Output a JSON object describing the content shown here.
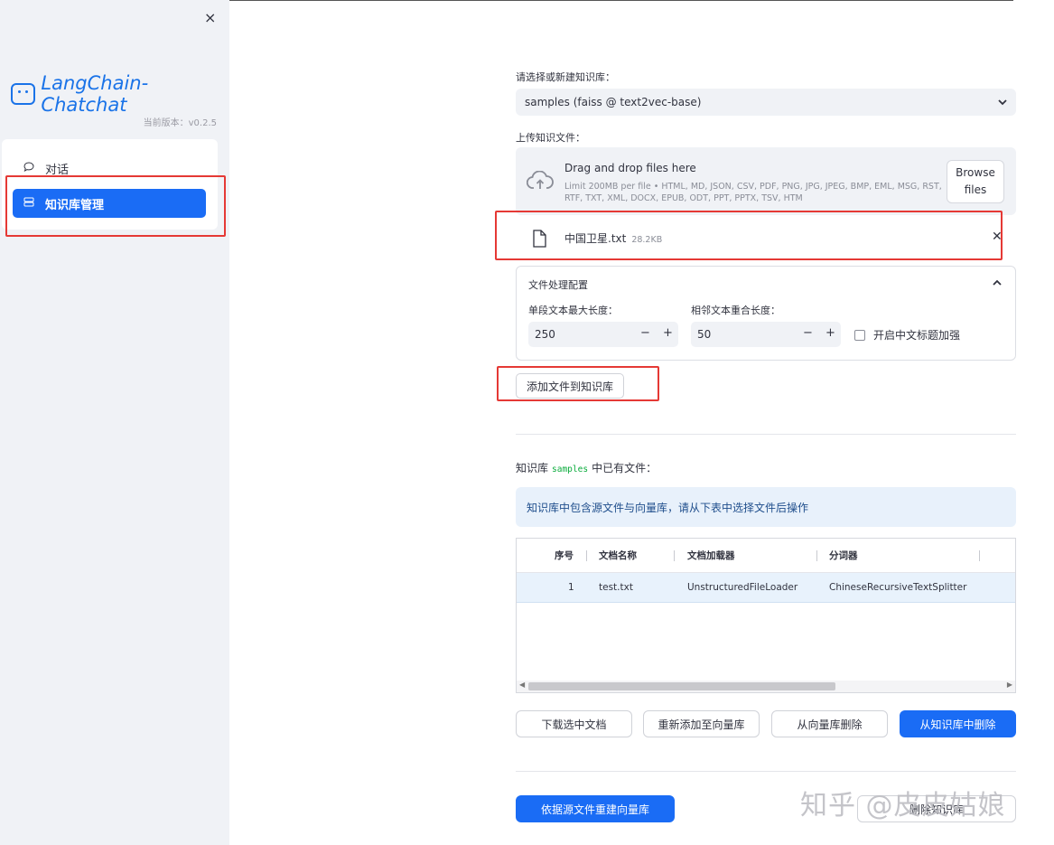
{
  "sidebar": {
    "close_glyph": "×",
    "logo_text": "LangChain-Chatchat",
    "version": "当前版本：v0.2.5",
    "nav": [
      {
        "label": "对话",
        "icon": "chat-bubble-icon"
      },
      {
        "label": "知识库管理",
        "icon": "database-icon"
      }
    ]
  },
  "kb_select": {
    "label": "请选择或新建知识库：",
    "value": "samples (faiss @ text2vec-base)"
  },
  "upload": {
    "label": "上传知识文件：",
    "drop_title": "Drag and drop files here",
    "limit": "Limit 200MB per file • HTML, MD, JSON, CSV, PDF, PNG, JPG, JPEG, BMP, EML, MSG, RST, RTF, TXT, XML, DOCX, EPUB, ODT, PPT, PPTX, TSV, HTM",
    "browse_label": "Browse files",
    "file_name": "中国卫星.txt",
    "file_size": "28.2KB"
  },
  "config": {
    "title": "文件处理配置",
    "max_len_label": "单段文本最大长度：",
    "max_len_value": "250",
    "overlap_label": "相邻文本重合长度：",
    "overlap_value": "50",
    "zh_title_label": "开启中文标题加强",
    "zh_title_checked": false
  },
  "add_button": "添加文件到知识库",
  "existing": {
    "prefix": "知识库",
    "kb_name": "samples",
    "suffix": "中已有文件：",
    "info": "知识库中包含源文件与向量库，请从下表中选择文件后操作",
    "columns": [
      "序号",
      "文档名称",
      "文档加载器",
      "分词器"
    ],
    "rows": [
      {
        "no": "1",
        "name": "test.txt",
        "loader": "UnstructuredFileLoader",
        "splitter": "ChineseRecursiveTextSplitter"
      }
    ]
  },
  "actions": {
    "download": "下载选中文档",
    "re_add": "重新添加至向量库",
    "delete_vs": "从向量库删除",
    "delete_kb_file": "从知识库中删除"
  },
  "bottom": {
    "rebuild": "依据源文件重建向量库",
    "delete_kb": "删除知识库"
  },
  "watermark": "知乎 @皮皮姑娘",
  "colors": {
    "primary": "#1a6cf5",
    "highlight": "#e53935"
  }
}
